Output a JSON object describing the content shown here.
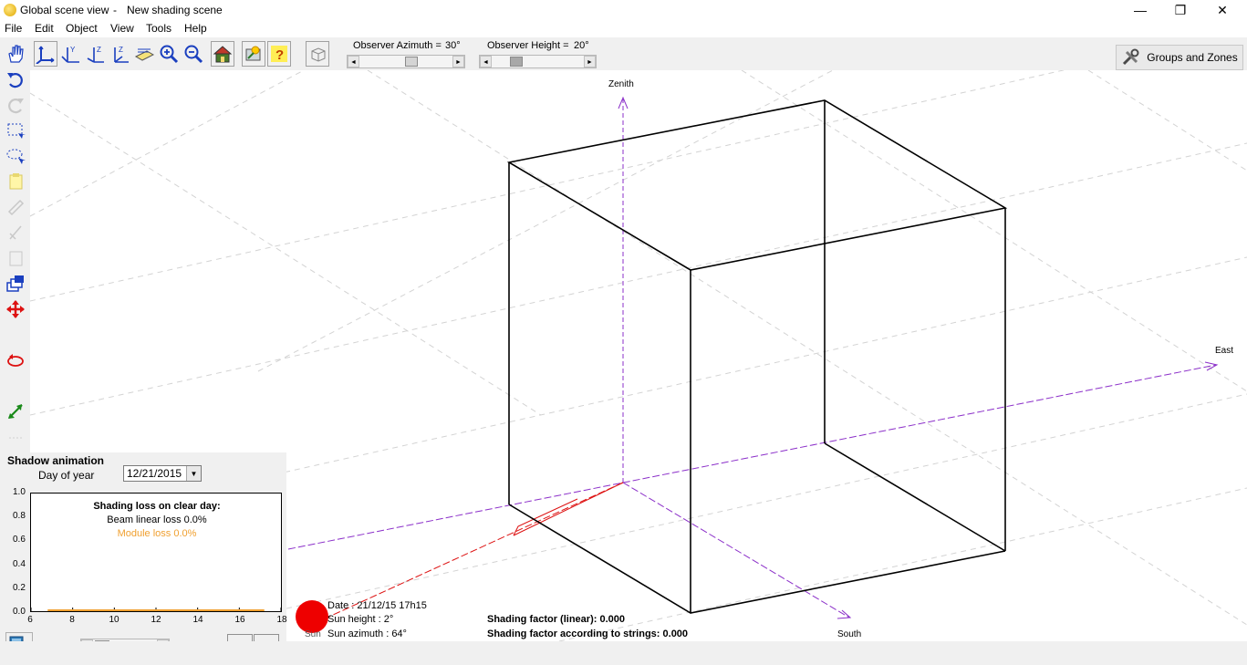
{
  "window": {
    "title": "Global scene view",
    "separator": "-",
    "document": "New shading scene",
    "minimize": "—",
    "restore": "❐",
    "close": "✕"
  },
  "menu": [
    "File",
    "Edit",
    "Object",
    "View",
    "Tools",
    "Help"
  ],
  "toolbar": {
    "azimuth_label": "Observer Azimuth =",
    "azimuth_value": "30°",
    "height_label": "Observer Height =",
    "height_value": "20°",
    "groups_button": "Groups and Zones"
  },
  "viewport": {
    "axis_zenith": "Zenith",
    "axis_east": "East",
    "axis_south": "South"
  },
  "shadow_animation": {
    "title": "Shadow animation",
    "day_label": "Day of year",
    "date": "12/21/2015"
  },
  "chart_data": {
    "type": "line",
    "title": "Shading loss on clear day:",
    "annotations": [
      "Beam linear loss 0.0%",
      "Module loss 0.0%"
    ],
    "x_ticks": [
      "6",
      "8",
      "10",
      "12",
      "14",
      "16",
      "18"
    ],
    "y_ticks": [
      "0.0",
      "0.2",
      "0.4",
      "0.6",
      "0.8",
      "1.0"
    ],
    "xlim": [
      6,
      18
    ],
    "ylim": [
      0,
      1
    ],
    "series": [
      {
        "x": [
          6.8,
          17.2
        ],
        "y": [
          0.0,
          0.0
        ],
        "color": "#f0a030"
      }
    ]
  },
  "sun": {
    "label": "Sun",
    "date": "Date :  21/12/15  17h15",
    "height": "Sun height : 2°",
    "azimuth": "Sun azimuth : 64°"
  },
  "shading": {
    "linear": "Shading factor (linear):  0.000",
    "strings": "Shading factor according to strings:  0.000"
  }
}
